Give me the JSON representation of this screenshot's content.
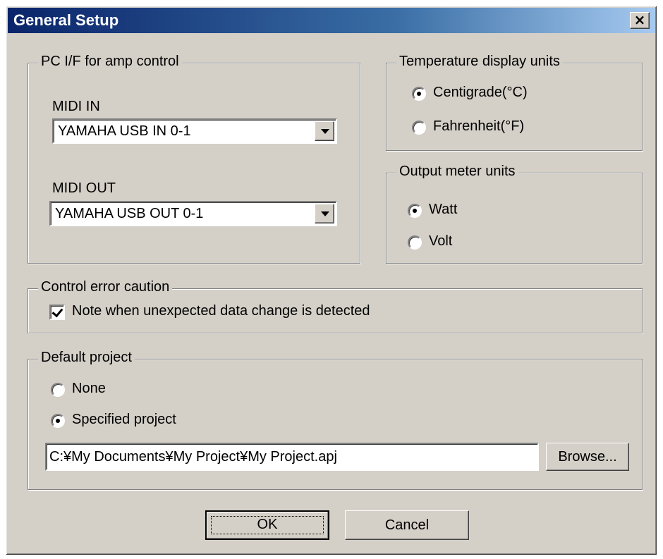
{
  "window": {
    "title": "General Setup",
    "close_glyph": "×"
  },
  "pc_if": {
    "legend": "PC I/F for amp control",
    "midi_in_label": "MIDI IN",
    "midi_in_value": "YAMAHA USB IN 0-1",
    "midi_out_label": "MIDI OUT",
    "midi_out_value": "YAMAHA USB OUT 0-1"
  },
  "temperature": {
    "legend": "Temperature display units",
    "options": [
      {
        "label": "Centigrade(°C)",
        "checked": true
      },
      {
        "label": "Fahrenheit(°F)",
        "checked": false
      }
    ]
  },
  "output_meter": {
    "legend": "Output meter units",
    "options": [
      {
        "label": "Watt",
        "checked": true
      },
      {
        "label": "Volt",
        "checked": false
      }
    ]
  },
  "control_error": {
    "legend": "Control error caution",
    "checkbox_label": "Note when unexpected data change is detected",
    "checked": true
  },
  "default_project": {
    "legend": "Default project",
    "options": [
      {
        "label": "None",
        "checked": false
      },
      {
        "label": "Specified project",
        "checked": true
      }
    ],
    "path_value": "C:¥My Documents¥My Project¥My Project.apj",
    "browse_label": "Browse..."
  },
  "footer": {
    "ok_label": "OK",
    "cancel_label": "Cancel"
  }
}
